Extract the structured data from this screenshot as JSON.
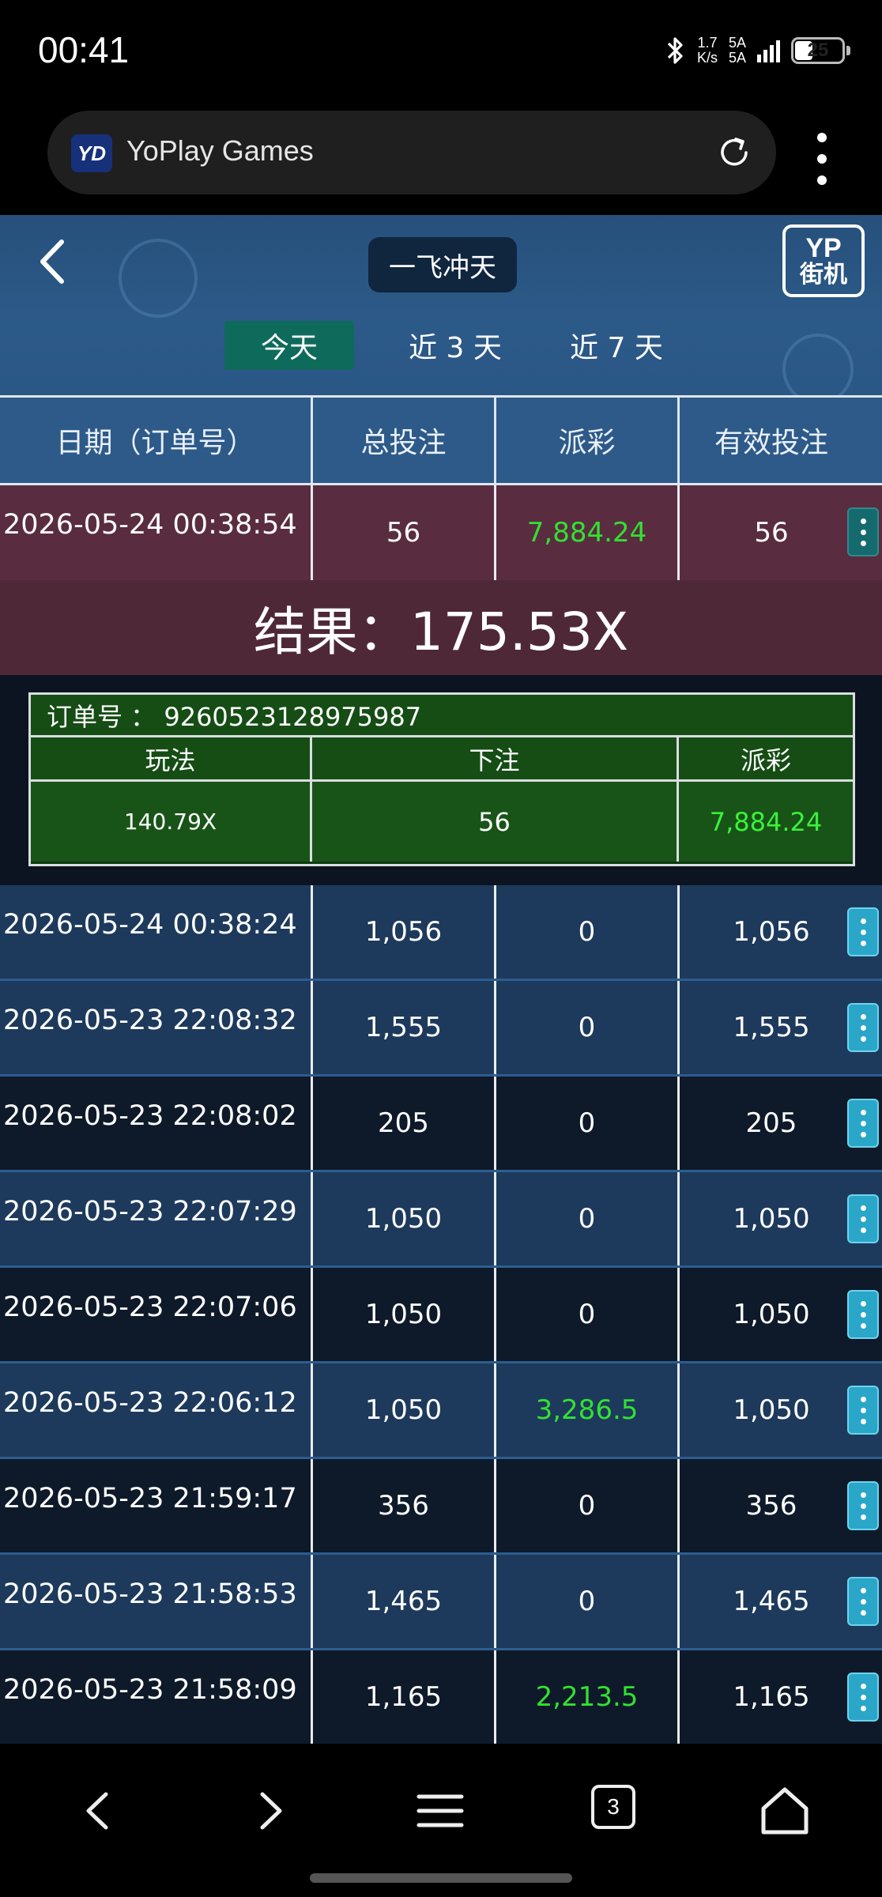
{
  "status_bar": {
    "time": "00:41",
    "net_speed_value": "1.7",
    "net_speed_unit": "K/s",
    "signal_label_1": "5A",
    "signal_label_2": "5A",
    "battery": "25"
  },
  "browser": {
    "site_logo": "YD",
    "site_title": "YoPlay Games",
    "tab_count": "3"
  },
  "game": {
    "title": "一飞冲天",
    "logo_top": "YP",
    "logo_bottom": "街机",
    "tabs": [
      {
        "label": "今天",
        "active": true
      },
      {
        "label": "近 3 天",
        "active": false
      },
      {
        "label": "近 7 天",
        "active": false
      }
    ]
  },
  "table": {
    "headers": [
      "日期（订单号）",
      "总投注",
      "派彩",
      "有效投注"
    ],
    "rows": [
      {
        "date": "2026-05-24 00:38:54",
        "total": "56",
        "payout": "7,884.24",
        "valid": "56",
        "payout_win": true
      },
      {
        "date": "2026-05-24 00:38:24",
        "total": "1,056",
        "payout": "0",
        "valid": "1,056",
        "payout_win": false
      },
      {
        "date": "2026-05-23 22:08:32",
        "total": "1,555",
        "payout": "0",
        "valid": "1,555",
        "payout_win": false
      },
      {
        "date": "2026-05-23 22:08:02",
        "total": "205",
        "payout": "0",
        "valid": "205",
        "payout_win": false
      },
      {
        "date": "2026-05-23 22:07:29",
        "total": "1,050",
        "payout": "0",
        "valid": "1,050",
        "payout_win": false
      },
      {
        "date": "2026-05-23 22:07:06",
        "total": "1,050",
        "payout": "0",
        "valid": "1,050",
        "payout_win": false
      },
      {
        "date": "2026-05-23 22:06:12",
        "total": "1,050",
        "payout": "3,286.5",
        "valid": "1,050",
        "payout_win": true
      },
      {
        "date": "2026-05-23 21:59:17",
        "total": "356",
        "payout": "0",
        "valid": "356",
        "payout_win": false
      },
      {
        "date": "2026-05-23 21:58:53",
        "total": "1,465",
        "payout": "0",
        "valid": "1,465",
        "payout_win": false
      },
      {
        "date": "2026-05-23 21:58:09",
        "total": "1,165",
        "payout": "2,213.5",
        "valid": "1,165",
        "payout_win": true
      }
    ]
  },
  "result": {
    "text": "结果：175.53X"
  },
  "detail": {
    "order_text": "订单号 ： 9260523128975987",
    "headers": [
      "玩法",
      "下注",
      "派彩"
    ],
    "values": [
      "140.79X",
      "56",
      "7,884.24"
    ]
  },
  "colors": {
    "win_green": "#33e033",
    "header_blue": "#2d5a89",
    "selected_row": "#5a2c40",
    "detail_green": "#185418",
    "menu_button": "#2aa6c9"
  }
}
